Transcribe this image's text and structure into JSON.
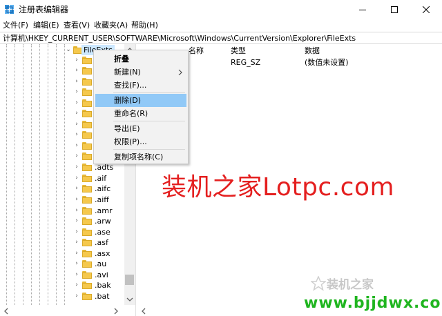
{
  "window": {
    "title": "注册表编辑器",
    "minimize_glyph": "—",
    "maximize_glyph": "☐",
    "close_glyph": "✕"
  },
  "menu": [
    "文件(F)",
    "编辑(E)",
    "查看(V)",
    "收藏夹(A)",
    "帮助(H)"
  ],
  "address": "计算机\\HKEY_CURRENT_USER\\SOFTWARE\\Microsoft\\Windows\\CurrentVersion\\Explorer\\FileExts",
  "tree": {
    "selected": "FileExts",
    "items": [
      ".adts",
      ".aif",
      ".aifc",
      ".aiff",
      ".amr",
      ".arw",
      ".ase",
      ".asf",
      ".asx",
      ".au",
      ".avi",
      ".bak",
      ".bat"
    ]
  },
  "list": {
    "columns": [
      "名称",
      "类型",
      "数据"
    ],
    "rows": [
      {
        "type": "REG_SZ",
        "data": "(数值未设置)"
      }
    ]
  },
  "context_menu": {
    "items": [
      {
        "label": "折叠",
        "bold": true
      },
      {
        "label": "新建(N)",
        "submenu": true
      },
      {
        "label": "查找(F)..."
      },
      {
        "label": "删除(D)",
        "highlighted": true
      },
      {
        "label": "重命名(R)"
      },
      {
        "label": "导出(E)"
      },
      {
        "label": "权限(P)..."
      },
      {
        "label": "复制项名称(C)"
      }
    ]
  },
  "watermarks": {
    "main": "装机之家Lotpc.com",
    "logo_text": "装机之家",
    "url": "www.bjjdwx.com"
  },
  "colors": {
    "highlight": "#91c9f7",
    "selected_tree": "#cce8ff",
    "watermark_red": "#e41f1f",
    "watermark_green": "#1fb51f",
    "folder": "#f5c84c"
  }
}
